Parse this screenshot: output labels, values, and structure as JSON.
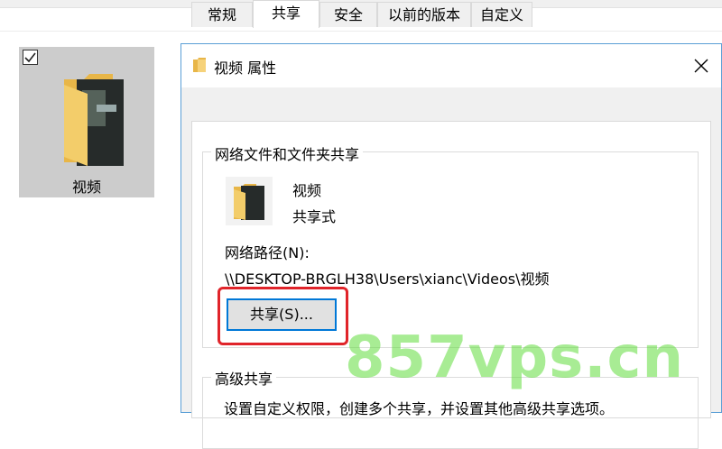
{
  "desktop_item": {
    "label": "视频",
    "selected": true
  },
  "dialog": {
    "title": "视频 属性",
    "tabs": [
      {
        "label": "常规",
        "active": false
      },
      {
        "label": "共享",
        "active": true
      },
      {
        "label": "安全",
        "active": false
      },
      {
        "label": "以前的版本",
        "active": false
      },
      {
        "label": "自定义",
        "active": false
      }
    ],
    "network_sharing": {
      "group_title": "网络文件和文件夹共享",
      "item_name": "视频",
      "item_state": "共享式",
      "path_label": "网络路径(N):",
      "path_value": "\\\\DESKTOP-BRGLH38\\Users\\xianc\\Videos\\视频",
      "share_button": "共享(S)..."
    },
    "advanced_sharing": {
      "group_title": "高级共享",
      "description": "设置自定义权限，创建多个共享，并设置其他高级共享选项。"
    }
  },
  "watermark": "857vps.cn",
  "colors": {
    "highlight_box": "#e0242a",
    "focus_border": "#0078d7",
    "watermark": "#60dc3c"
  }
}
